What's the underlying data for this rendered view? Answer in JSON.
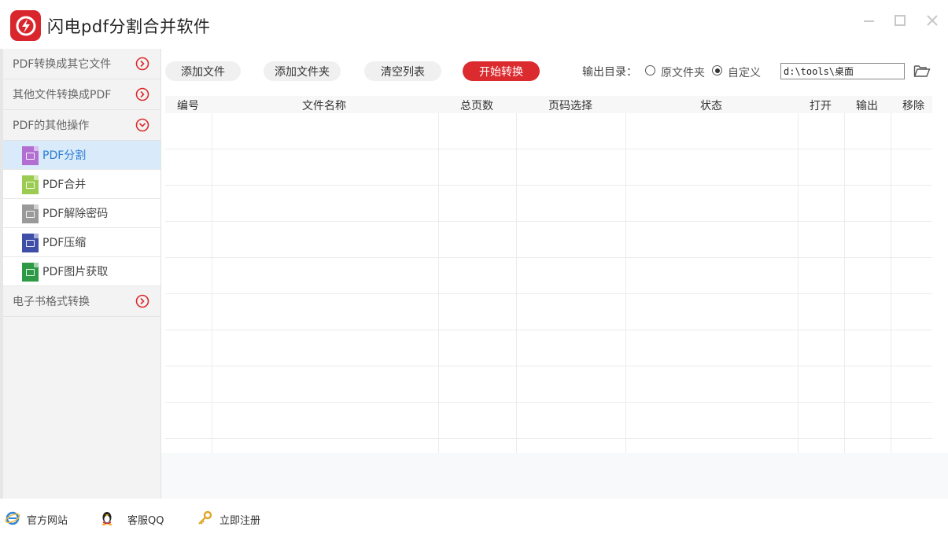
{
  "app": {
    "title": "闪电pdf分割合并软件",
    "accent": "#dc2b2f"
  },
  "sidebar": {
    "categories": [
      {
        "label": "PDF转换成其它文件",
        "state": "collapsed"
      },
      {
        "label": "其他文件转换成PDF",
        "state": "collapsed"
      },
      {
        "label": "PDF的其他操作",
        "state": "expanded"
      },
      {
        "label": "电子书格式转换",
        "state": "collapsed"
      }
    ],
    "sub_items": [
      {
        "label": "PDF分割",
        "icon": "split-file-icon",
        "color": "#b26fd1",
        "active": true
      },
      {
        "label": "PDF合并",
        "icon": "merge-file-icon",
        "color": "#9ccb52",
        "active": false
      },
      {
        "label": "PDF解除密码",
        "icon": "unlock-file-icon",
        "color": "#9a9a9a",
        "active": false
      },
      {
        "label": "PDF压缩",
        "icon": "compress-file-icon",
        "color": "#3f4fa8",
        "active": false
      },
      {
        "label": "PDF图片获取",
        "icon": "image-file-icon",
        "color": "#2e9a45",
        "active": false
      }
    ]
  },
  "toolbar": {
    "add_file": "添加文件",
    "add_folder": "添加文件夹",
    "clear_list": "清空列表",
    "start": "开始转换",
    "output_label": "输出目录：",
    "option_original": "原文件夹",
    "option_custom": "自定义",
    "selected_option": "custom",
    "output_path": "d:\\tools\\桌面"
  },
  "table": {
    "columns": [
      "编号",
      "文件名称",
      "总页数",
      "页码选择",
      "状态",
      "打开",
      "输出",
      "移除"
    ],
    "rows": []
  },
  "footer": {
    "website": "官方网站",
    "support": "客服QQ",
    "register": "立即注册"
  }
}
